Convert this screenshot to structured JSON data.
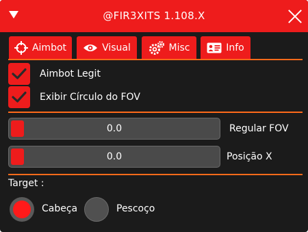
{
  "window": {
    "title": "@FIR3XITS 1.108.X"
  },
  "tabs": [
    {
      "label": "Aimbot",
      "icon": "crosshair-icon"
    },
    {
      "label": "Visual",
      "icon": "eye-icon"
    },
    {
      "label": "Misc",
      "icon": "gears-icon"
    },
    {
      "label": "Info",
      "icon": "id-card-icon"
    }
  ],
  "checkboxes": [
    {
      "label": "Aimbot Legit",
      "checked": true
    },
    {
      "label": "Exibir Círculo do FOV",
      "checked": true
    }
  ],
  "sliders": [
    {
      "label": "Regular FOV",
      "value": "0.0"
    },
    {
      "label": "Posição X",
      "value": "0.0"
    }
  ],
  "target": {
    "label": "Target :",
    "options": [
      {
        "label": "Cabeça",
        "selected": true
      },
      {
        "label": "Pescoço",
        "selected": false
      }
    ]
  },
  "colors": {
    "accent": "#ee1c1c",
    "divider": "#ff6a1a",
    "panel": "#1b1b1b"
  }
}
